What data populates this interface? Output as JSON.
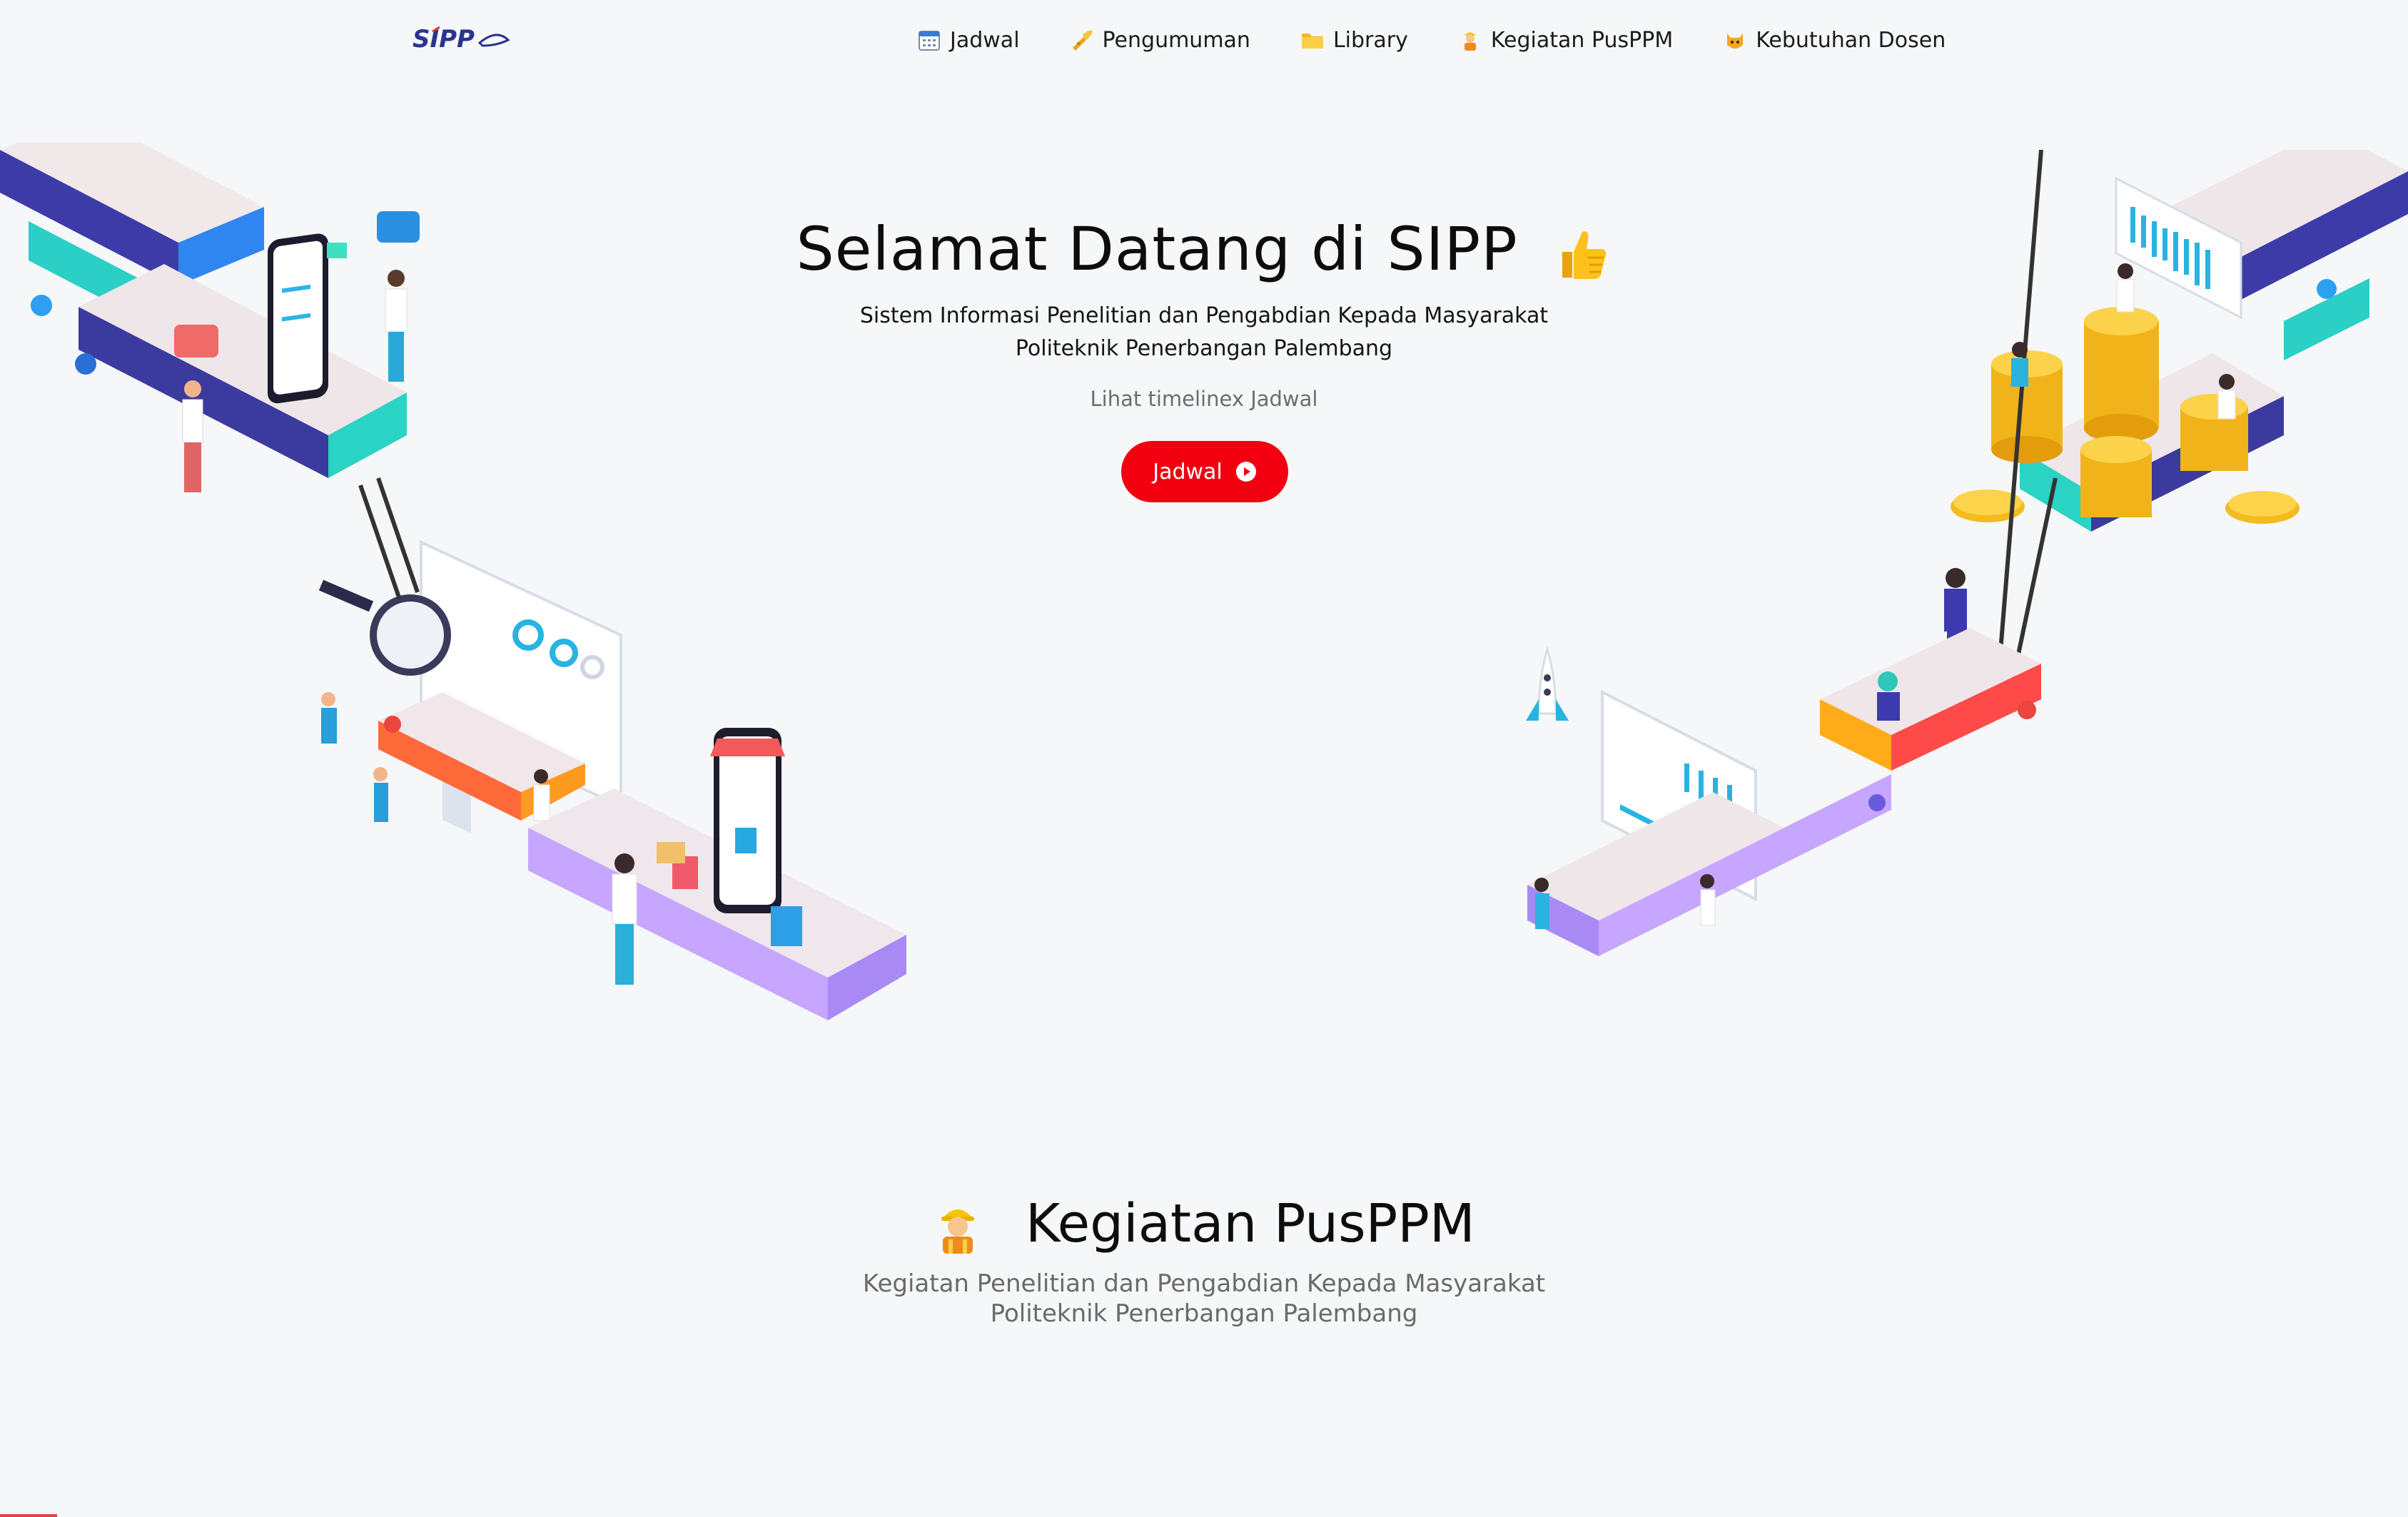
{
  "brand": {
    "logo_text": "SIPP",
    "logo_color": "#2a3590",
    "logo_accent": "#e33a2a"
  },
  "nav": {
    "items": [
      {
        "label": "Jadwal",
        "icon": "calendar-icon"
      },
      {
        "label": "Pengumuman",
        "icon": "trumpet-icon"
      },
      {
        "label": "Library",
        "icon": "folder-icon"
      },
      {
        "label": "Kegiatan PusPPM",
        "icon": "worker-icon"
      },
      {
        "label": "Kebutuhan Dosen",
        "icon": "cat-icon"
      }
    ]
  },
  "hero": {
    "title": "Selamat Datang di SIPP",
    "title_icon": "thumbs-up-icon",
    "subtitle_line1": "Sistem Informasi Penelitian dan Pengabdian Kepada Masyarakat",
    "subtitle_line2": "Politeknik Penerbangan Palembang",
    "hint": "Lihat timelinex Jadwal",
    "button_label": "Jadwal",
    "button_color": "#f2000f"
  },
  "section": {
    "title": "Kegiatan PusPPM",
    "title_icon": "worker-icon",
    "subtitle_line1": "Kegiatan Penelitian dan Pengabdian Kepada Masyarakat",
    "subtitle_line2": "Politeknik Penerbangan Palembang"
  }
}
